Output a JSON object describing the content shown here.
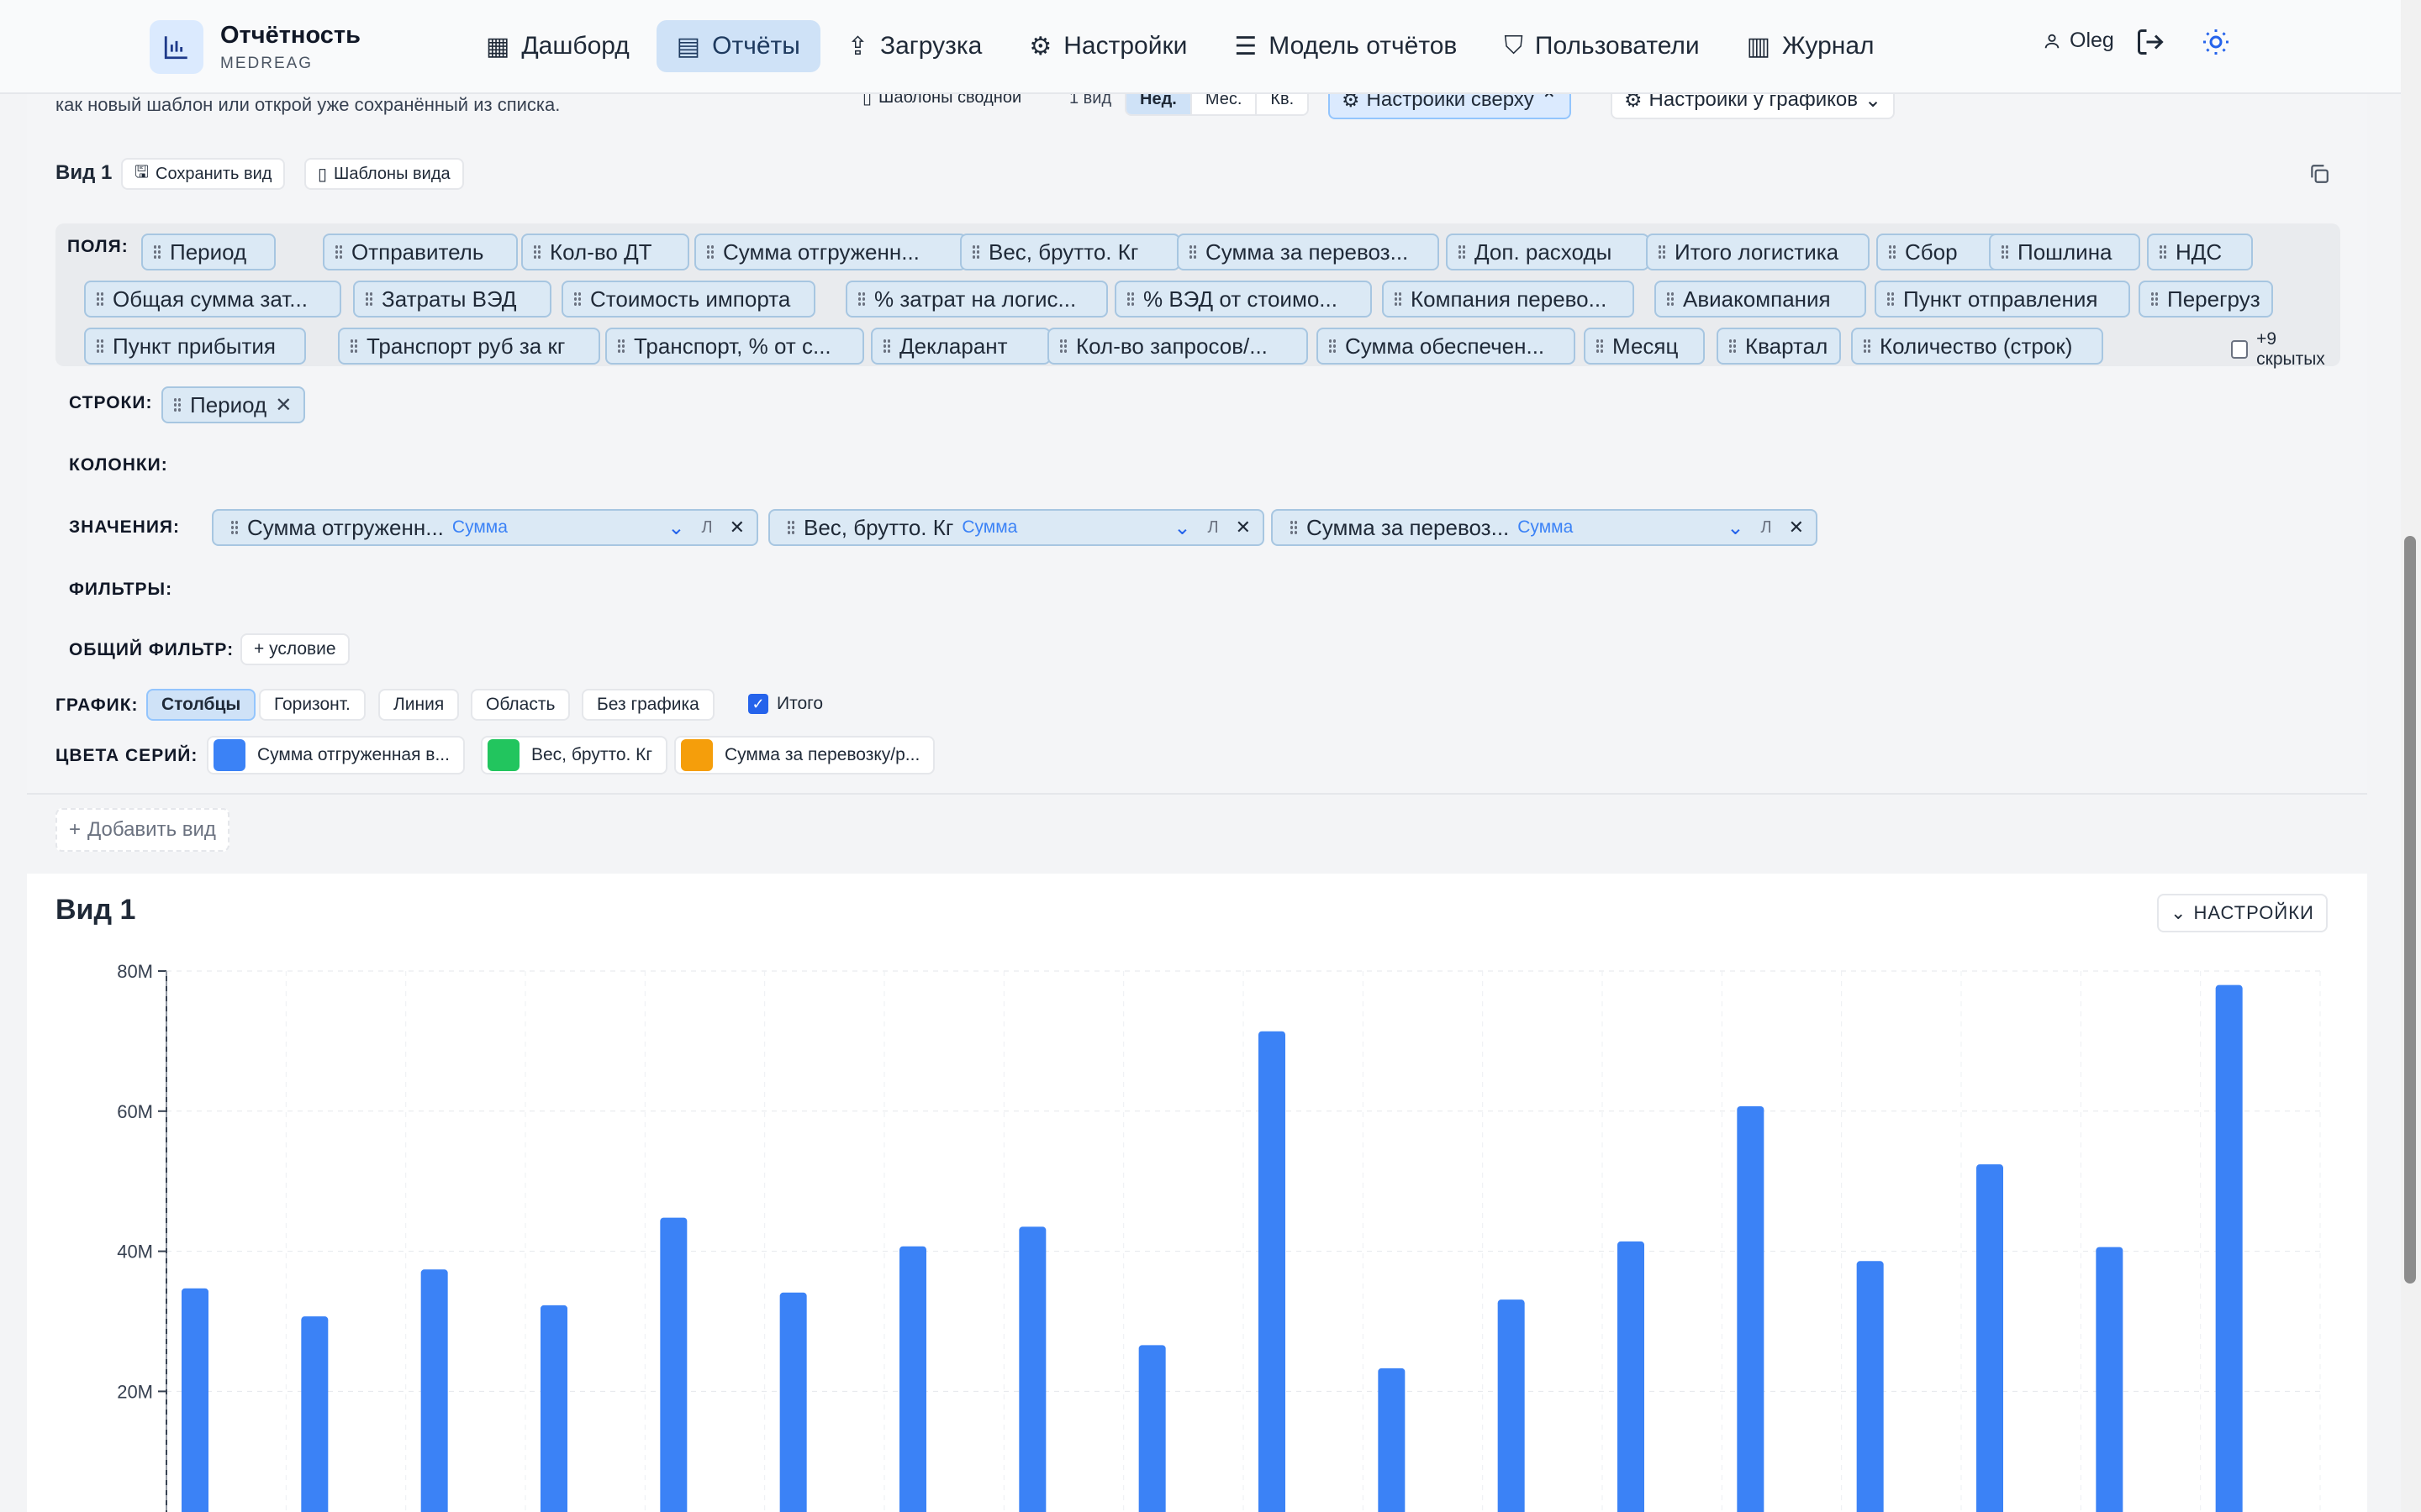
{
  "app": {
    "title": "Отчётность",
    "subtitle": "MEDREAG"
  },
  "nav": [
    {
      "label": "Дашборд",
      "icon": "dashboard-icon",
      "active": false
    },
    {
      "label": "Отчёты",
      "icon": "report-icon",
      "active": true
    },
    {
      "label": "Загрузка",
      "icon": "upload-icon",
      "active": false
    },
    {
      "label": "Настройки",
      "icon": "gear-icon",
      "active": false
    },
    {
      "label": "Модель отчётов",
      "icon": "sliders-icon",
      "active": false
    },
    {
      "label": "Пользователи",
      "icon": "shield-icon",
      "active": false
    },
    {
      "label": "Журнал",
      "icon": "scroll-icon",
      "active": false
    }
  ],
  "user": {
    "name": "Oleg"
  },
  "toolbar": {
    "hint": "как новый шаблон или открой уже сохранённый из списка.",
    "pivot_templates": "Шаблоны сводной",
    "views_count": "1 вид",
    "periods": [
      "Нед.",
      "Мес.",
      "Кв."
    ],
    "settings_top": "Настройки сверху",
    "settings_charts": "Настройки у графиков"
  },
  "view": {
    "title": "Вид 1",
    "save": "Сохранить вид",
    "templates": "Шаблоны вида",
    "fields_label": "ПОЛЯ:",
    "fields": [
      "Период",
      "Отправитель",
      "Кол-во ДТ",
      "Сумма отгруженн...",
      "Вес, брутто. Кг",
      "Сумма за перевоз...",
      "Доп. расходы",
      "Итого логистика",
      "Сбор",
      "Пошлина",
      "НДС",
      "Общая сумма зат...",
      "Затраты ВЭД",
      "Стоимость импорта",
      "% затрат на логис...",
      "% ВЭД от стоимо...",
      "Компания перево...",
      "Авиакомпания",
      "Пункт отправления",
      "Перегруз",
      "Пункт прибытия",
      "Транспорт руб за кг",
      "Транспорт, % от с...",
      "Декларант",
      "Кол-во запросов/...",
      "Сумма обеспечен...",
      "Месяц",
      "Квартал",
      "Количество (строк)"
    ],
    "hidden": "+9 скрытых",
    "rows_label": "СТРОКИ:",
    "rows": [
      "Период"
    ],
    "cols_label": "КОЛОНКИ:",
    "values_label": "ЗНАЧЕНИЯ:",
    "values": [
      {
        "name": "Сумма отгруженн...",
        "agg": "Сумма",
        "flag": "Л"
      },
      {
        "name": "Вес, брутто. Кг",
        "agg": "Сумма",
        "flag": "Л"
      },
      {
        "name": "Сумма за перевоз...",
        "agg": "Сумма",
        "flag": "Л"
      }
    ],
    "filters_label": "ФИЛЬТРЫ:",
    "global_filter_label": "ОБЩИЙ ФИЛЬТР:",
    "add_condition": "+ условие",
    "chart_label": "ГРАФИК:",
    "chart_types": [
      "Столбцы",
      "Горизонт.",
      "Линия",
      "Область",
      "Без графика"
    ],
    "total": "Итого",
    "colors_label": "ЦВЕТА СЕРИЙ:",
    "series_colors": [
      {
        "name": "Сумма отгруженная в...",
        "color": "#3b82f6"
      },
      {
        "name": "Вес, брутто. Кг",
        "color": "#22c55e"
      },
      {
        "name": "Сумма за перевозку/р...",
        "color": "#f59e0b"
      }
    ]
  },
  "add_view": "Добавить вид",
  "chart_section": {
    "title": "Вид 1",
    "settings": "НАСТРОЙКИ"
  },
  "chart_data": {
    "type": "bar",
    "ylim": [
      0,
      80000000
    ],
    "y_ticks": [
      "20M",
      "40M",
      "60M",
      "80M"
    ],
    "grid": true,
    "series": [
      {
        "name": "Сумма отгруженная в...",
        "color": "#3b82f6",
        "values": [
          34700000,
          30700000,
          37400000,
          32300000,
          44800000,
          34100000,
          40700000,
          43500000,
          26600000,
          71400000,
          23300000,
          33100000,
          41400000,
          60700000,
          38600000,
          52400000,
          40600000,
          78000000
        ]
      },
      {
        "name": "Вес, брутто. Кг",
        "color": "#22c55e",
        "values": [
          0,
          0,
          0,
          0,
          0,
          0,
          0,
          0,
          0,
          0,
          0,
          0,
          0,
          0,
          0,
          0,
          0,
          0
        ]
      },
      {
        "name": "Сумма за перевозку/р...",
        "color": "#f59e0b",
        "values": [
          0,
          0,
          300000,
          0,
          0,
          0,
          0,
          0,
          0,
          0,
          600000,
          0,
          0,
          300000,
          500000,
          0,
          0,
          0
        ]
      }
    ]
  }
}
